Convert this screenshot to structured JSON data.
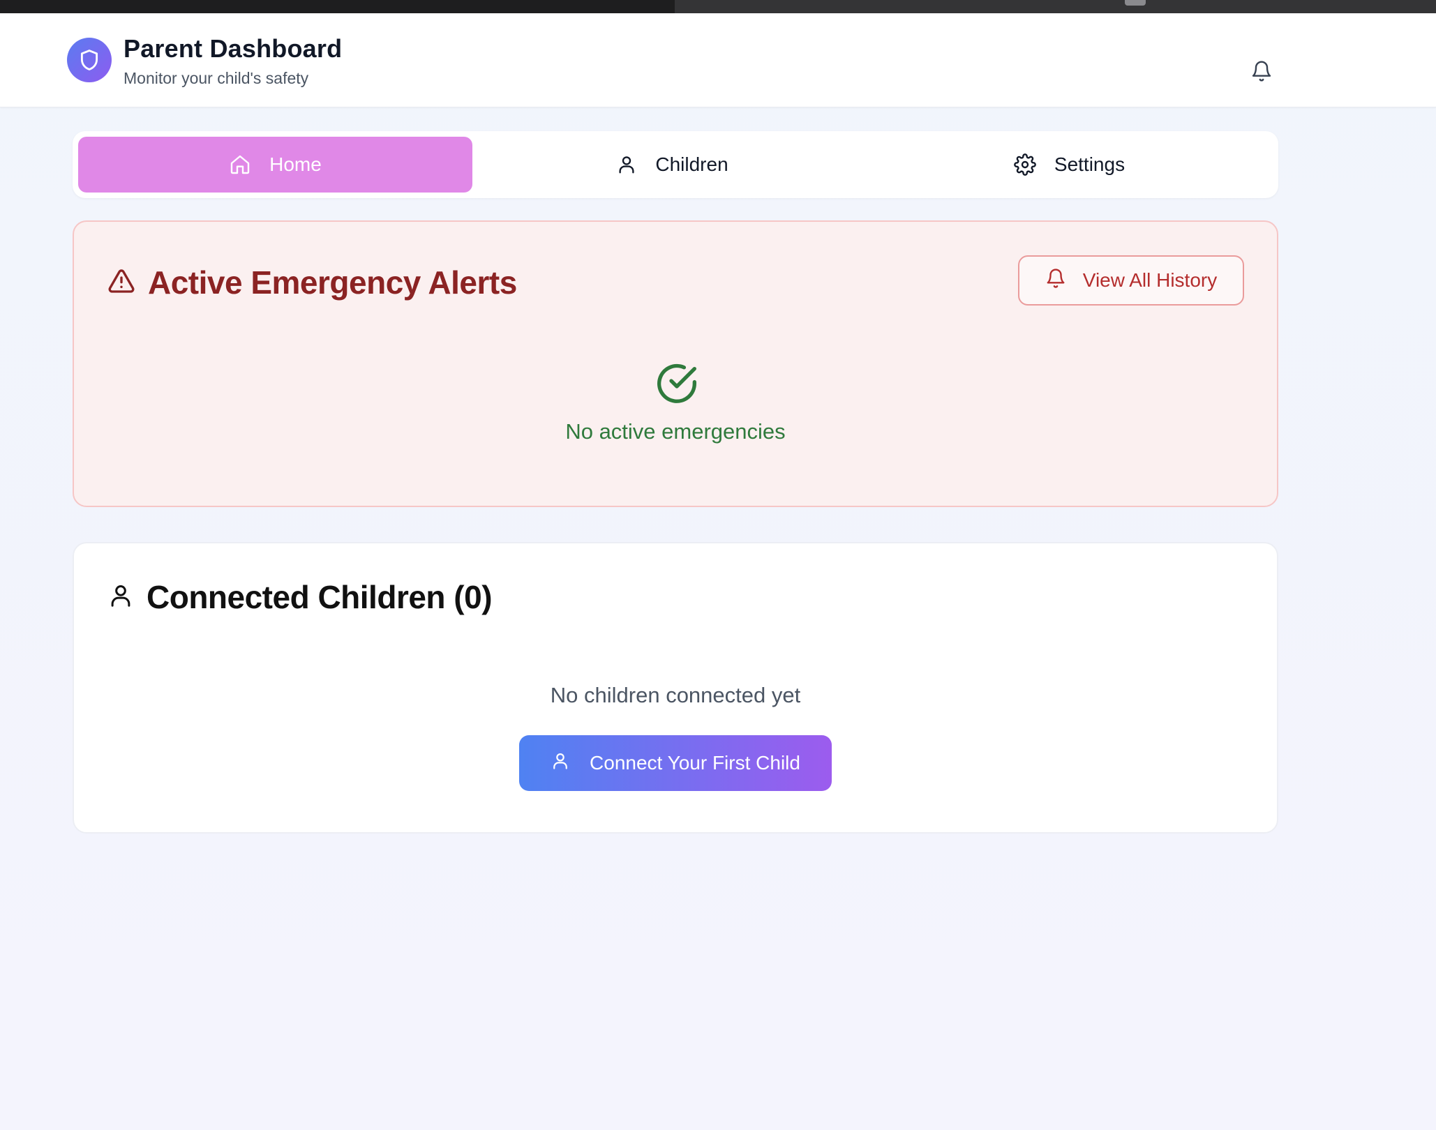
{
  "header": {
    "title": "Parent Dashboard",
    "subtitle": "Monitor your child's safety",
    "logo_icon": "shield-icon",
    "notifications_icon": "bell-icon"
  },
  "tabs": [
    {
      "label": "Home",
      "icon": "home-icon",
      "active": true
    },
    {
      "label": "Children",
      "icon": "user-icon",
      "active": false
    },
    {
      "label": "Settings",
      "icon": "gear-icon",
      "active": false
    }
  ],
  "alerts": {
    "title": "Active Emergency Alerts",
    "icon": "warning-icon",
    "history_button_label": "View All History",
    "history_button_icon": "bell-icon",
    "status_icon": "check-circle-icon",
    "status_text": "No active emergencies"
  },
  "children": {
    "title": "Connected Children (0)",
    "icon": "user-icon",
    "empty_text": "No children connected yet",
    "connect_button_label": "Connect Your First Child",
    "connect_button_icon": "user-icon"
  },
  "colors": {
    "active_tab": "#e088e7",
    "alert_title": "#8b2323",
    "alert_background": "#fbf0f0",
    "success": "#2f7a3c",
    "button_gradient_start": "#4f82f2",
    "button_gradient_end": "#9c5cee"
  }
}
